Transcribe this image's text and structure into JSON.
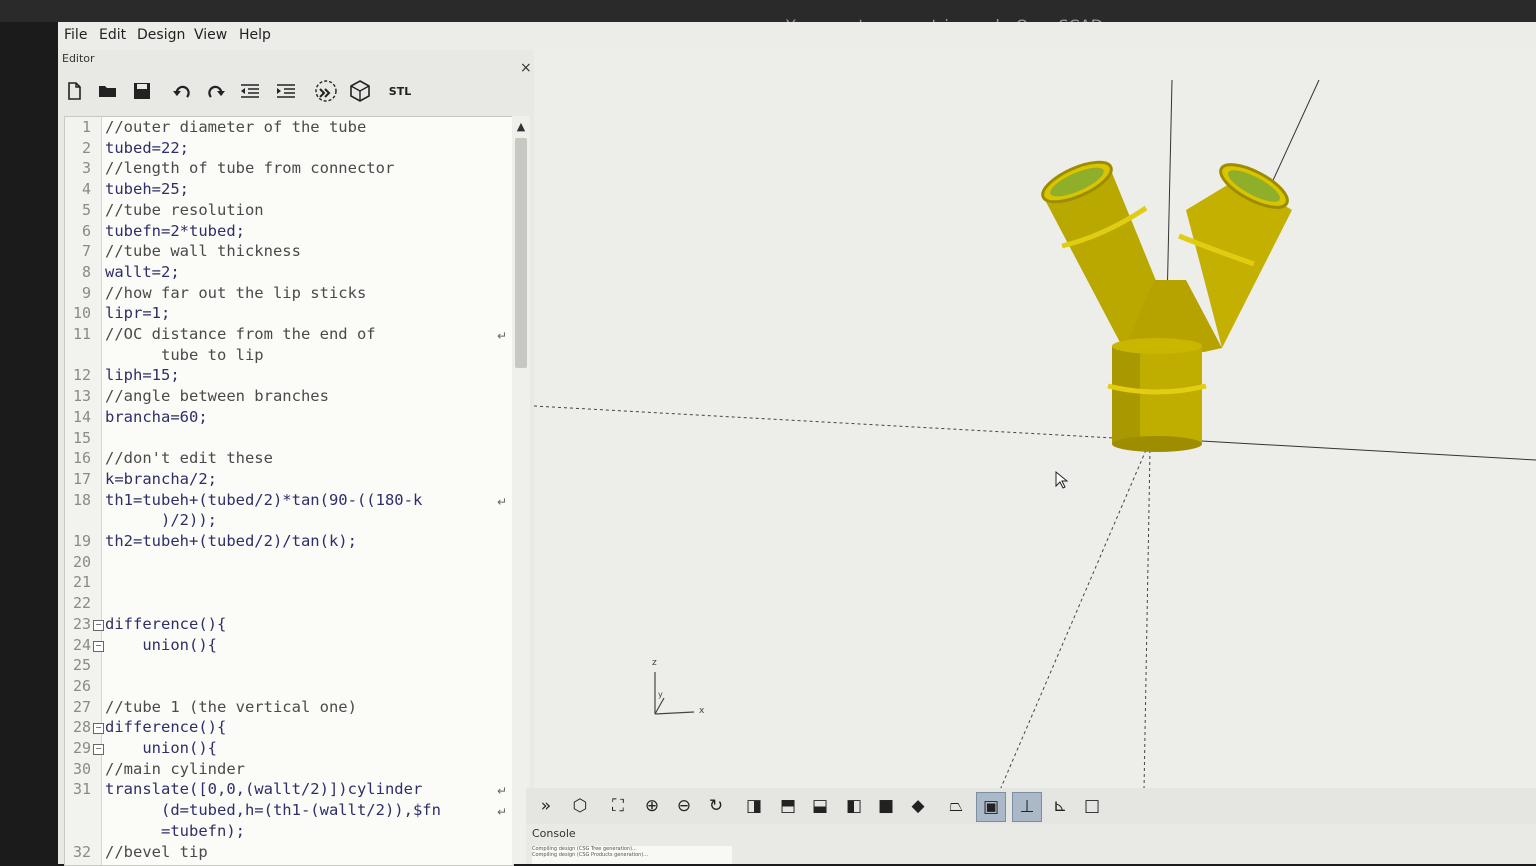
{
  "window": {
    "title": "Y connect parametric.scad - OpenSCAD"
  },
  "menu": [
    "File",
    "Edit",
    "Design",
    "View",
    "Help"
  ],
  "editor": {
    "dock_title": "Editor",
    "close_glyph": "×",
    "toolbar_icons": [
      "new-file-icon",
      "open-folder-icon",
      "save-icon",
      "undo-icon",
      "redo-icon",
      "unindent-icon",
      "indent-icon",
      "preview-icon",
      "render-icon",
      "export-stl-icon"
    ],
    "stl_label": "STL",
    "lines": [
      {
        "n": "1",
        "text": "//outer diameter of the tube",
        "comment": true
      },
      {
        "n": "2",
        "text": "tubed=22;"
      },
      {
        "n": "3",
        "text": "//length of tube from connector",
        "comment": true
      },
      {
        "n": "4",
        "text": "tubeh=25;"
      },
      {
        "n": "5",
        "text": "//tube resolution",
        "comment": true
      },
      {
        "n": "6",
        "text": "tubefn=2*tubed;"
      },
      {
        "n": "7",
        "text": "//tube wall thickness",
        "comment": true
      },
      {
        "n": "8",
        "text": "wallt=2;"
      },
      {
        "n": "9",
        "text": "//how far out the lip sticks",
        "comment": true
      },
      {
        "n": "10",
        "text": "lipr=1;"
      },
      {
        "n": "11",
        "text": "//OC distance from the end of",
        "comment": true,
        "wrap": true
      },
      {
        "n": "",
        "text": "      tube to lip",
        "comment": true
      },
      {
        "n": "12",
        "text": "liph=15;"
      },
      {
        "n": "13",
        "text": "//angle between branches",
        "comment": true
      },
      {
        "n": "14",
        "text": "brancha=60;"
      },
      {
        "n": "15",
        "text": ""
      },
      {
        "n": "16",
        "text": "//don't edit these",
        "comment": true
      },
      {
        "n": "17",
        "text": "k=brancha/2;"
      },
      {
        "n": "18",
        "text": "th1=tubeh+(tubed/2)*tan(90-((180-k",
        "wrap": true
      },
      {
        "n": "",
        "text": "      )/2));"
      },
      {
        "n": "19",
        "text": "th2=tubeh+(tubed/2)/tan(k);"
      },
      {
        "n": "20",
        "text": ""
      },
      {
        "n": "21",
        "text": ""
      },
      {
        "n": "22",
        "text": ""
      },
      {
        "n": "23",
        "text": "difference(){",
        "fold": true
      },
      {
        "n": "24",
        "text": "    union(){",
        "fold": true
      },
      {
        "n": "25",
        "text": ""
      },
      {
        "n": "26",
        "text": ""
      },
      {
        "n": "27",
        "text": "//tube 1 (the vertical one)",
        "comment": true
      },
      {
        "n": "28",
        "text": "difference(){",
        "fold": true
      },
      {
        "n": "29",
        "text": "    union(){",
        "fold": true
      },
      {
        "n": "30",
        "text": "//main cylinder",
        "comment": true
      },
      {
        "n": "31",
        "text": "translate([0,0,(wallt/2)])cylinder",
        "wrap": true
      },
      {
        "n": "",
        "text": "      (d=tubed,h=(th1-(wallt/2)),$fn",
        "wrap": true
      },
      {
        "n": "",
        "text": "      =tubefn);"
      },
      {
        "n": "32",
        "text": "//bevel tip",
        "comment": true
      }
    ]
  },
  "viewport": {
    "axis_z": "z",
    "axis_y": "y",
    "axis_x": "x",
    "model_color": "#c8b400",
    "model_inner_color": "#8fae2a"
  },
  "view_toolbar_icons": [
    "preview-icon",
    "render-icon",
    "view-all-icon",
    "zoom-in-icon",
    "zoom-out-icon",
    "reset-view-icon",
    "view-right-icon",
    "view-top-icon",
    "view-bottom-icon",
    "view-left-icon",
    "view-front-icon",
    "view-back-icon",
    "perspective-icon",
    "orthogonal-icon",
    "show-axes-icon",
    "show-scale-icon",
    "show-edges-icon"
  ],
  "console": {
    "title": "Console",
    "lines": [
      "Compiling design (CSG Tree generation)...",
      "Compiling design (CSG Products generation)..."
    ]
  }
}
